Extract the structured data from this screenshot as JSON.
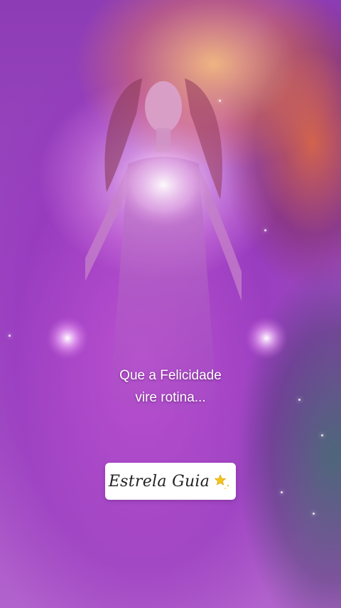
{
  "caption": {
    "line1": "Que a Felicidade",
    "line2": "vire rotina..."
  },
  "brand": {
    "name": "Estrela Guia",
    "icon": "star-moon-icon"
  },
  "colors": {
    "background_purple": "#9b47c0",
    "glow_orange": "#ff8c3c",
    "glow_teal": "#286e5a",
    "caption_text": "#ffffff",
    "brand_card": "#ffffff"
  }
}
